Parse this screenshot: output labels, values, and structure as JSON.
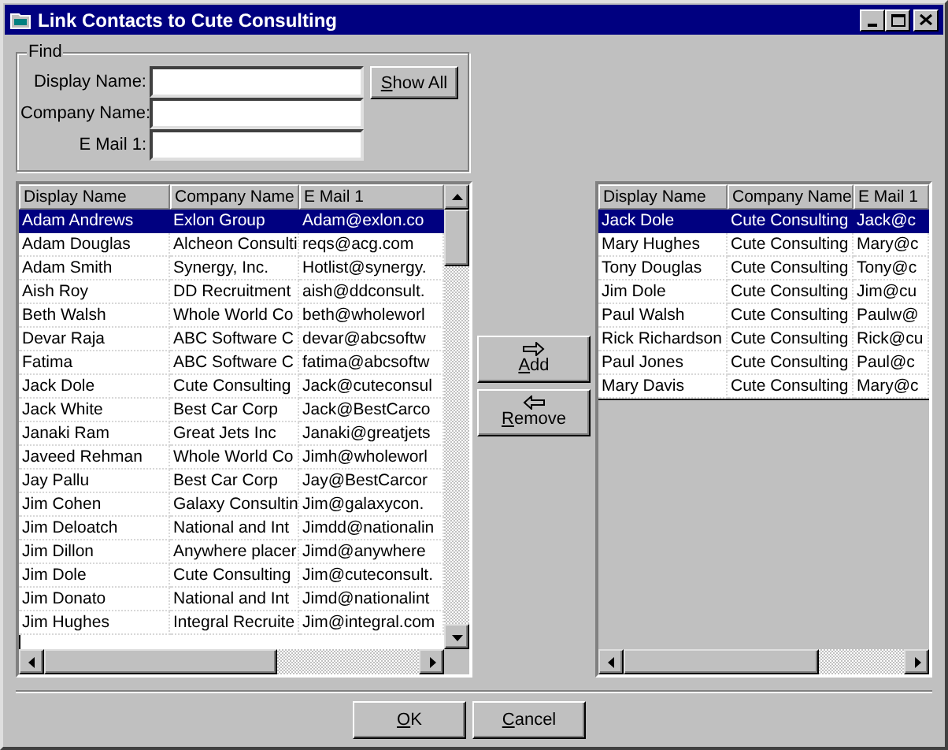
{
  "window": {
    "title": "Link Contacts to Cute Consulting"
  },
  "find": {
    "title": "Find",
    "fields": [
      {
        "label": "Display Name:"
      },
      {
        "label": "Company Name:"
      },
      {
        "label": "E Mail 1:"
      }
    ],
    "show_all_button": "Show All"
  },
  "contacts": {
    "columns": [
      "Display Name",
      "Company Name",
      "E Mail 1"
    ],
    "rows": [
      {
        "cells": [
          "Adam Andrews",
          "Exlon Group",
          "Adam@exlon.co"
        ],
        "selected": true
      },
      {
        "cells": [
          "Adam Douglas",
          "Alcheon Consulti",
          "reqs@acg.com"
        ],
        "selected": false
      },
      {
        "cells": [
          "Adam Smith",
          "Synergy, Inc.",
          "Hotlist@synergy."
        ],
        "selected": false
      },
      {
        "cells": [
          "Aish Roy",
          "DD Recruitment",
          "aish@ddconsult."
        ],
        "selected": false
      },
      {
        "cells": [
          "Beth Walsh",
          "Whole World Co",
          "beth@wholeworl"
        ],
        "selected": false
      },
      {
        "cells": [
          "Devar Raja",
          "ABC Software C",
          "devar@abcsoftw"
        ],
        "selected": false
      },
      {
        "cells": [
          "Fatima",
          "ABC Software C",
          "fatima@abcsoftw"
        ],
        "selected": false
      },
      {
        "cells": [
          "Jack Dole",
          "Cute Consulting",
          "Jack@cuteconsul"
        ],
        "selected": false
      },
      {
        "cells": [
          "Jack White",
          "Best Car Corp",
          "Jack@BestCarco"
        ],
        "selected": false
      },
      {
        "cells": [
          "Janaki Ram",
          "Great Jets Inc",
          "Janaki@greatjets"
        ],
        "selected": false
      },
      {
        "cells": [
          "Javeed Rehman",
          "Whole World Co",
          "Jimh@wholeworl"
        ],
        "selected": false
      },
      {
        "cells": [
          "Jay Pallu",
          "Best Car Corp",
          "Jay@BestCarcor"
        ],
        "selected": false
      },
      {
        "cells": [
          "Jim Cohen",
          "Galaxy Consultin",
          "Jim@galaxycon."
        ],
        "selected": false
      },
      {
        "cells": [
          "Jim Deloatch",
          "National and Int",
          "Jimdd@nationalin"
        ],
        "selected": false
      },
      {
        "cells": [
          "Jim Dillon",
          "Anywhere placer",
          "Jimd@anywhere"
        ],
        "selected": false
      },
      {
        "cells": [
          "Jim Dole",
          "Cute Consulting",
          "Jim@cuteconsult."
        ],
        "selected": false
      },
      {
        "cells": [
          "Jim Donato",
          "National and Int",
          "Jimd@nationalint"
        ],
        "selected": false
      },
      {
        "cells": [
          "Jim Hughes",
          "Integral Recruite",
          "Jim@integral.com"
        ],
        "selected": false
      }
    ]
  },
  "actions": [
    {
      "label": "Add",
      "kind": "add"
    },
    {
      "label": "Remove",
      "kind": "remove"
    }
  ],
  "linked": {
    "columns": [
      "Display Name",
      "Company Name",
      "E Mail 1"
    ],
    "rows": [
      {
        "cells": [
          "Jack Dole",
          "Cute Consulting",
          "Jack@c"
        ],
        "selected": true
      },
      {
        "cells": [
          "Mary Hughes",
          "Cute Consulting",
          "Mary@c"
        ],
        "selected": false
      },
      {
        "cells": [
          "Tony Douglas",
          "Cute Consulting",
          "Tony@c"
        ],
        "selected": false
      },
      {
        "cells": [
          "Jim Dole",
          "Cute Consulting",
          "Jim@cu"
        ],
        "selected": false
      },
      {
        "cells": [
          "Paul Walsh",
          "Cute Consulting",
          "Paulw@"
        ],
        "selected": false
      },
      {
        "cells": [
          "Rick Richardson",
          "Cute Consulting",
          "Rick@cu"
        ],
        "selected": false
      },
      {
        "cells": [
          "Paul Jones",
          "Cute Consulting",
          "Paul@c"
        ],
        "selected": false
      },
      {
        "cells": [
          "Mary Davis",
          "Cute Consulting",
          "Mary@c"
        ],
        "selected": false
      }
    ]
  },
  "buttons": [
    "OK",
    "Cancel"
  ]
}
